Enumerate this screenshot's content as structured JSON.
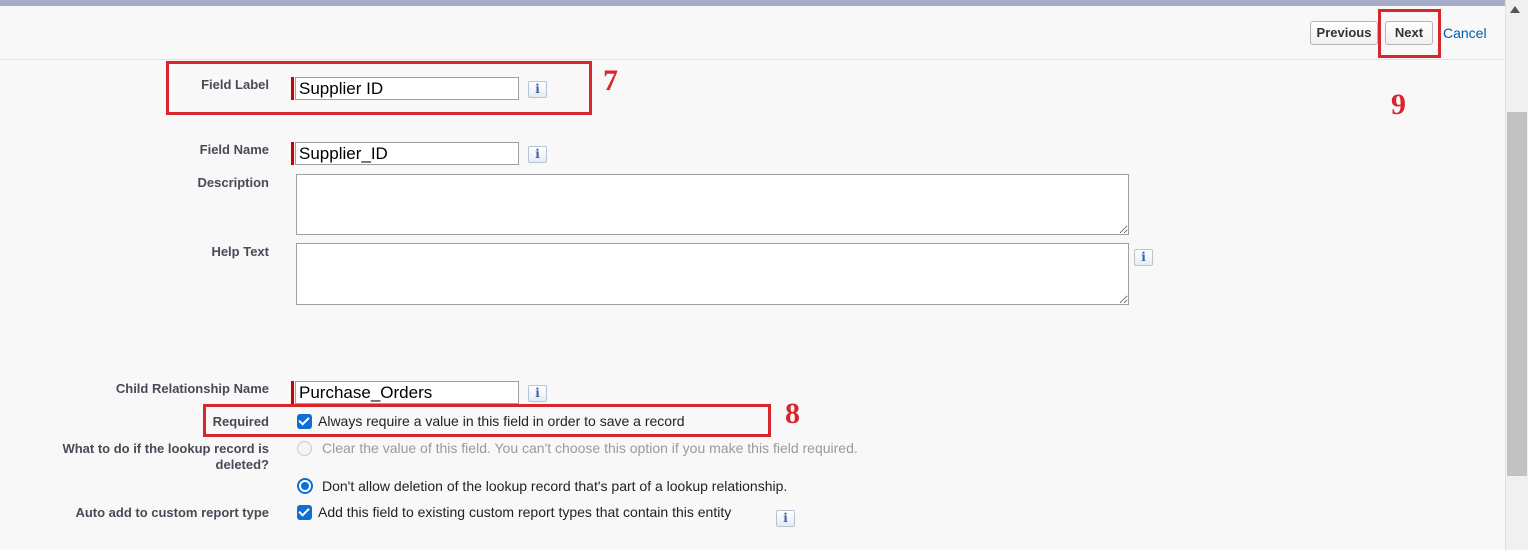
{
  "buttons": {
    "previous": "Previous",
    "next": "Next",
    "cancel": "Cancel"
  },
  "fields": {
    "field_label": {
      "label": "Field Label",
      "value": "Supplier ID"
    },
    "field_name": {
      "label": "Field Name",
      "value": "Supplier_ID"
    },
    "description": {
      "label": "Description",
      "value": ""
    },
    "help_text": {
      "label": "Help Text",
      "value": ""
    },
    "child_relationship": {
      "label": "Child Relationship Name",
      "value": "Purchase_Orders"
    },
    "required": {
      "label": "Required",
      "checkbox_text": "Always require a value in this field in order to save a record",
      "checked": true
    },
    "lookup_deleted": {
      "label_line1": "What to do if the lookup record is",
      "label_line2": "deleted?",
      "option_clear": "Clear the value of this field. You can't choose this option if you make this field required.",
      "option_dont_allow": "Don't allow deletion of the lookup record that's part of a lookup relationship.",
      "selected": "dont_allow"
    },
    "auto_add": {
      "label": "Auto add to custom report type",
      "checkbox_text": "Add this field to existing custom report types that contain this entity",
      "checked": true
    }
  },
  "info_icon_glyph": "i",
  "annotations": {
    "n7": "7",
    "n8": "8",
    "n9": "9"
  },
  "colors": {
    "annotation": "#d9262d",
    "required_bar": "#cc0000",
    "link": "#015ba7",
    "checkbox": "#0b6fd6"
  }
}
